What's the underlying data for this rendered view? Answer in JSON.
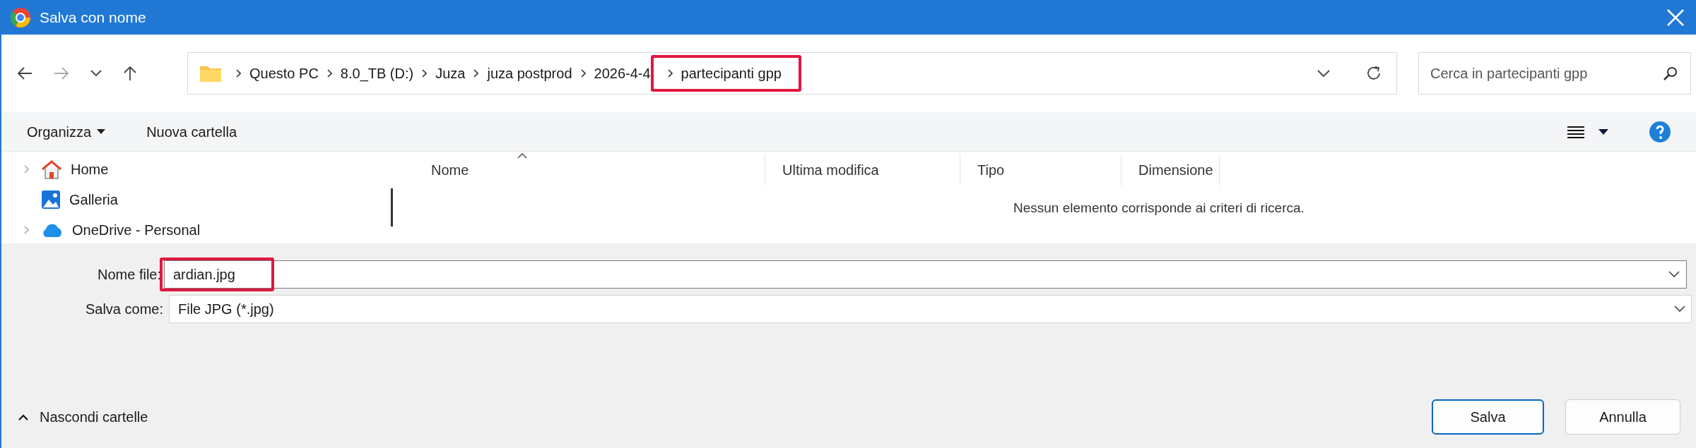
{
  "window": {
    "title": "Salva con nome"
  },
  "breadcrumbs": [
    {
      "label": "Questo PC",
      "highlighted": false
    },
    {
      "label": "8.0_TB (D:)",
      "highlighted": false
    },
    {
      "label": "Juza",
      "highlighted": false
    },
    {
      "label": "juza postprod",
      "highlighted": false
    },
    {
      "label": "2026-4-4",
      "highlighted": false
    },
    {
      "label": "partecipanti gpp",
      "highlighted": true
    }
  ],
  "search": {
    "placeholder": "Cerca in partecipanti gpp"
  },
  "toolbar": {
    "organize": "Organizza",
    "new_folder": "Nuova cartella"
  },
  "sidebar": {
    "items": [
      {
        "label": "Home",
        "kind": "home",
        "expandable": true
      },
      {
        "label": "Galleria",
        "kind": "gallery",
        "expandable": false
      },
      {
        "label": "OneDrive - Personal",
        "kind": "cloud",
        "expandable": true
      }
    ]
  },
  "table": {
    "columns": [
      "Nome",
      "Ultima modifica",
      "Tipo",
      "Dimensione"
    ],
    "empty_message": "Nessun elemento corrisponde ai criteri di ricerca."
  },
  "file_name": {
    "label": "Nome file:",
    "value": "ardian.jpg",
    "highlighted": true
  },
  "save_as": {
    "label": "Salva come:",
    "value": "File JPG (*.jpg)"
  },
  "footer": {
    "toggle": "Nascondi cartelle",
    "buttons": [
      {
        "label": "Salva",
        "primary": true
      },
      {
        "label": "Annulla",
        "primary": false
      }
    ]
  }
}
